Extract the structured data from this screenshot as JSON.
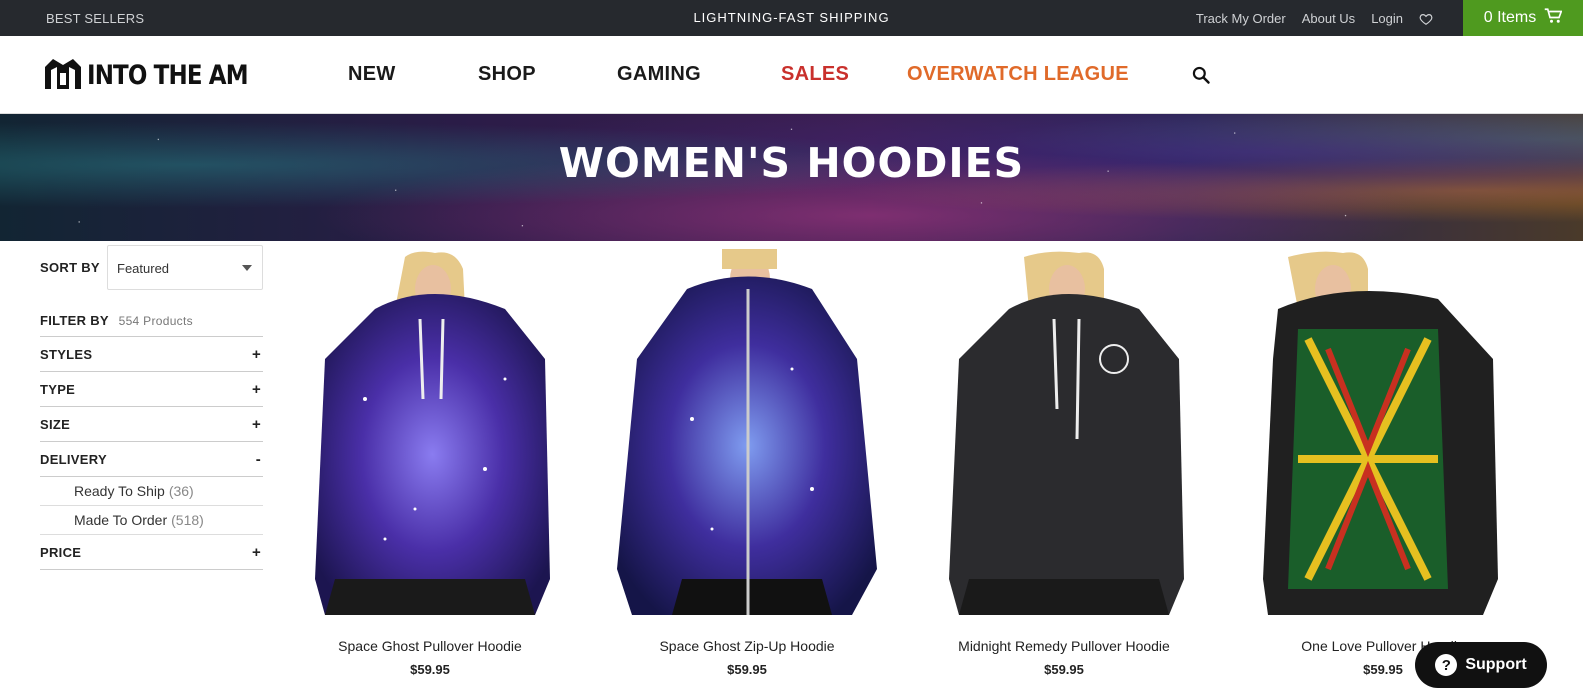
{
  "topbar": {
    "best_sellers": "BEST SELLERS",
    "promo": "LIGHTNING-FAST SHIPPING",
    "track_order": "Track My Order",
    "about_us": "About Us",
    "login": "Login",
    "cart": "0 Items"
  },
  "brand": {
    "name": "INTO THE AM"
  },
  "nav": {
    "new": "NEW",
    "shop": "SHOP",
    "gaming": "GAMING",
    "sales": "SALES",
    "overwatch": "OVERWATCH LEAGUE"
  },
  "colors": {
    "sales": "#c9302c",
    "overwatch": "#e06a2a",
    "cart_bg": "#4f9a1f",
    "topbar_bg": "#26292e"
  },
  "banner": {
    "title": "WOMEN'S HOODIES"
  },
  "sidebar": {
    "sort_label": "SORT BY",
    "sort_value": "Featured",
    "filter_label": "FILTER BY",
    "product_count": "554 Products",
    "facets": [
      {
        "label": "STYLES",
        "toggle": "+"
      },
      {
        "label": "TYPE",
        "toggle": "+"
      },
      {
        "label": "SIZE",
        "toggle": "+"
      },
      {
        "label": "DELIVERY",
        "toggle": "-"
      },
      {
        "label": "PRICE",
        "toggle": "+"
      }
    ],
    "delivery_options": [
      {
        "label": "Ready To Ship",
        "count": "(36)"
      },
      {
        "label": "Made To Order",
        "count": "(518)"
      }
    ]
  },
  "products": [
    {
      "name": "Space Ghost Pullover Hoodie",
      "price": "$59.95"
    },
    {
      "name": "Space Ghost Zip-Up Hoodie",
      "price": "$59.95"
    },
    {
      "name": "Midnight Remedy Pullover Hoodie",
      "price": "$59.95"
    },
    {
      "name": "One Love Pullover Hoodie",
      "price": "$59.95"
    }
  ],
  "support": {
    "label": "Support"
  }
}
